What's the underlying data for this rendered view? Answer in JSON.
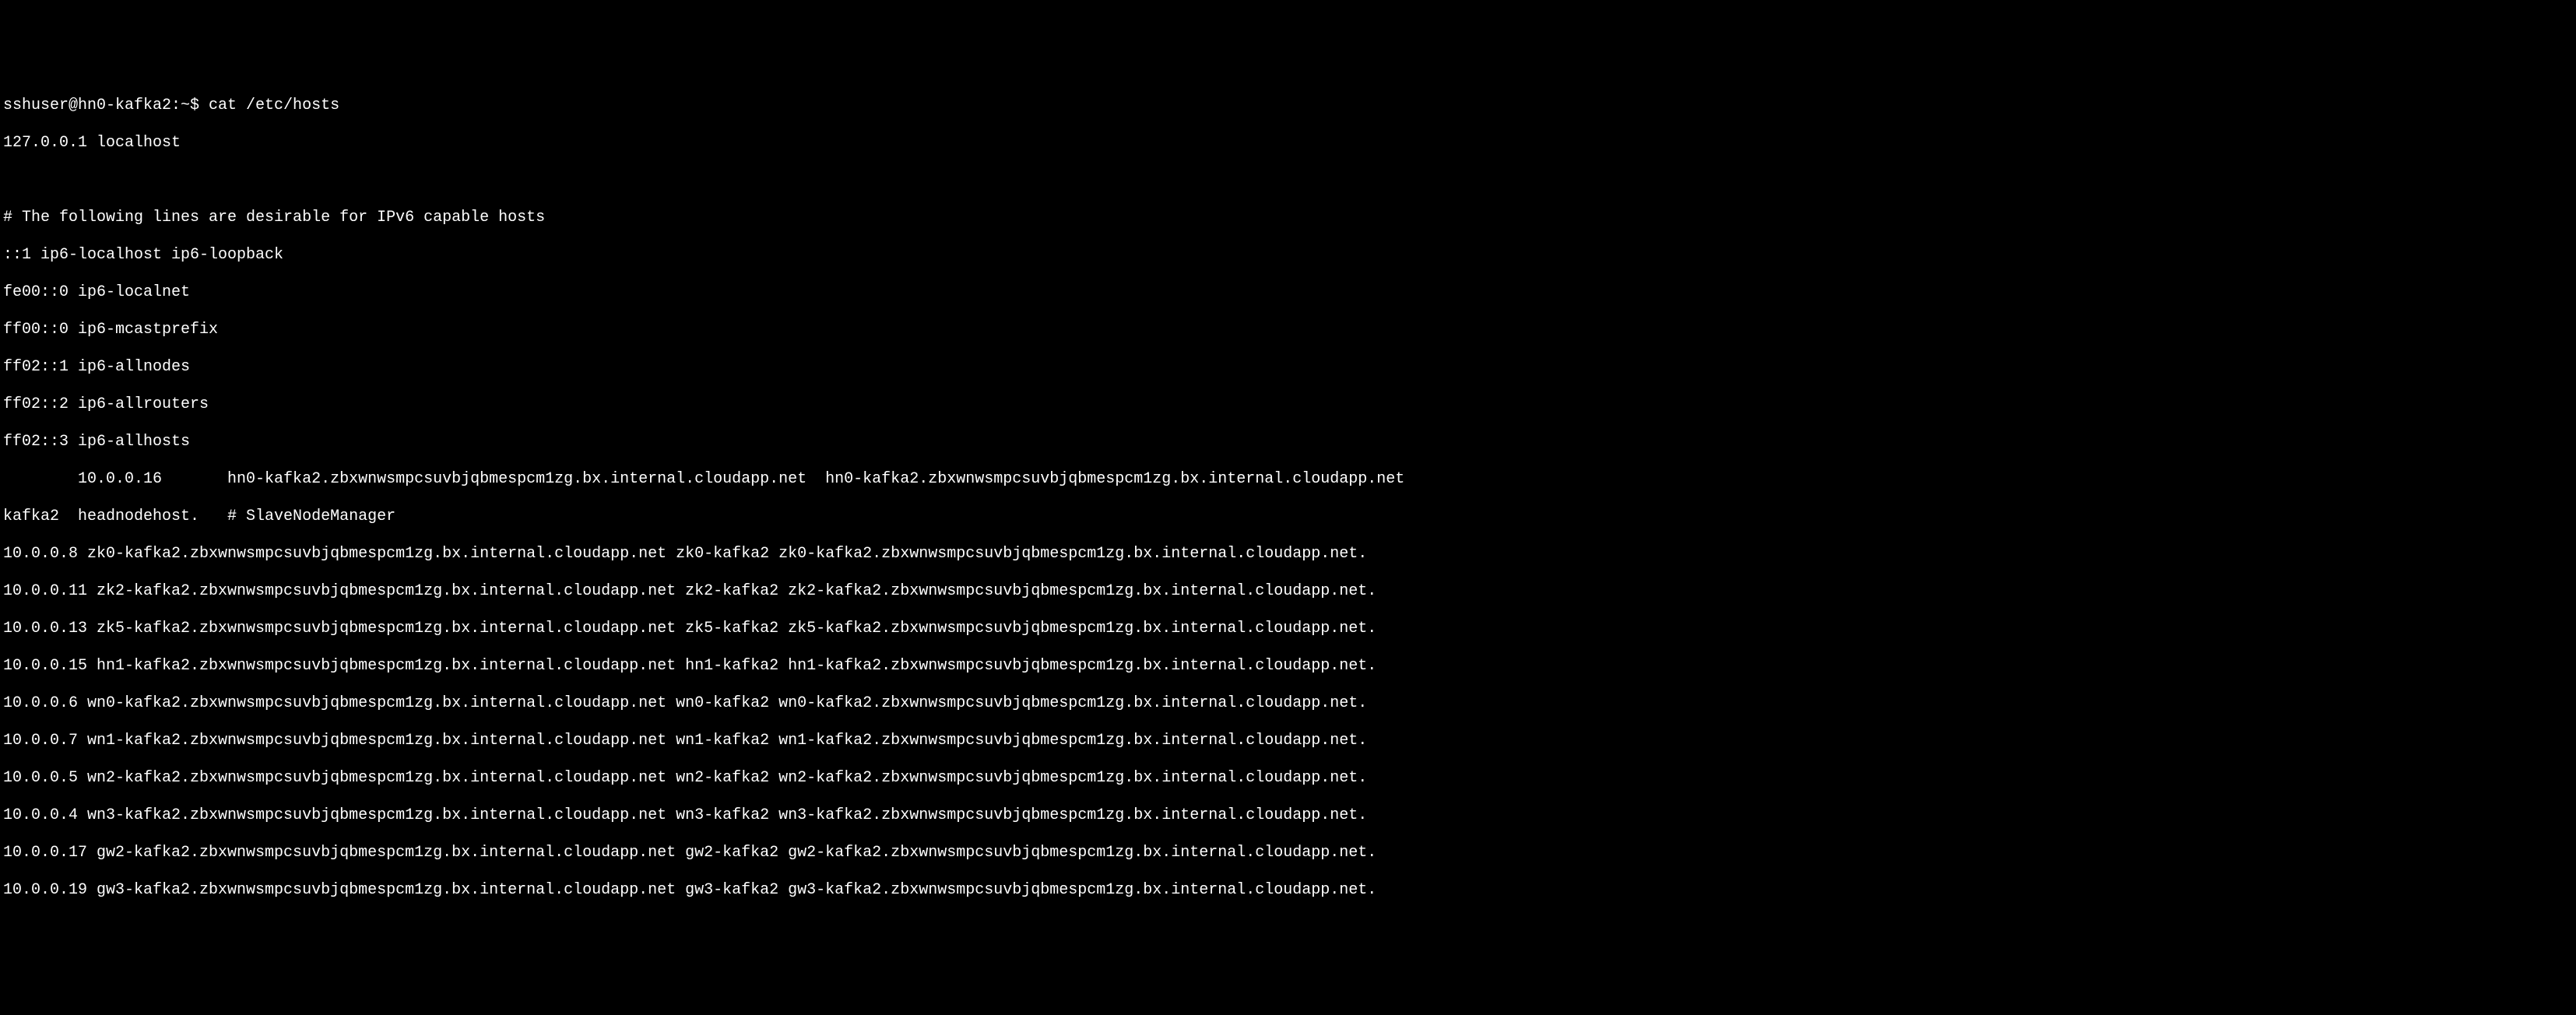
{
  "terminal": {
    "prompt_line": "sshuser@hn0-kafka2:~$ cat /etc/hosts",
    "lines": [
      "127.0.0.1 localhost",
      "",
      "# The following lines are desirable for IPv6 capable hosts",
      "::1 ip6-localhost ip6-loopback",
      "fe00::0 ip6-localnet",
      "ff00::0 ip6-mcastprefix",
      "ff02::1 ip6-allnodes",
      "ff02::2 ip6-allrouters",
      "ff02::3 ip6-allhosts",
      "        10.0.0.16       hn0-kafka2.zbxwnwsmpcsuvbjqbmespcm1zg.bx.internal.cloudapp.net  hn0-kafka2.zbxwnwsmpcsuvbjqbmespcm1zg.bx.internal.cloudapp.net",
      "kafka2  headnodehost.   # SlaveNodeManager",
      "10.0.0.8 zk0-kafka2.zbxwnwsmpcsuvbjqbmespcm1zg.bx.internal.cloudapp.net zk0-kafka2 zk0-kafka2.zbxwnwsmpcsuvbjqbmespcm1zg.bx.internal.cloudapp.net.",
      "10.0.0.11 zk2-kafka2.zbxwnwsmpcsuvbjqbmespcm1zg.bx.internal.cloudapp.net zk2-kafka2 zk2-kafka2.zbxwnwsmpcsuvbjqbmespcm1zg.bx.internal.cloudapp.net.",
      "10.0.0.13 zk5-kafka2.zbxwnwsmpcsuvbjqbmespcm1zg.bx.internal.cloudapp.net zk5-kafka2 zk5-kafka2.zbxwnwsmpcsuvbjqbmespcm1zg.bx.internal.cloudapp.net.",
      "10.0.0.15 hn1-kafka2.zbxwnwsmpcsuvbjqbmespcm1zg.bx.internal.cloudapp.net hn1-kafka2 hn1-kafka2.zbxwnwsmpcsuvbjqbmespcm1zg.bx.internal.cloudapp.net.",
      "10.0.0.6 wn0-kafka2.zbxwnwsmpcsuvbjqbmespcm1zg.bx.internal.cloudapp.net wn0-kafka2 wn0-kafka2.zbxwnwsmpcsuvbjqbmespcm1zg.bx.internal.cloudapp.net.",
      "10.0.0.7 wn1-kafka2.zbxwnwsmpcsuvbjqbmespcm1zg.bx.internal.cloudapp.net wn1-kafka2 wn1-kafka2.zbxwnwsmpcsuvbjqbmespcm1zg.bx.internal.cloudapp.net.",
      "10.0.0.5 wn2-kafka2.zbxwnwsmpcsuvbjqbmespcm1zg.bx.internal.cloudapp.net wn2-kafka2 wn2-kafka2.zbxwnwsmpcsuvbjqbmespcm1zg.bx.internal.cloudapp.net.",
      "10.0.0.4 wn3-kafka2.zbxwnwsmpcsuvbjqbmespcm1zg.bx.internal.cloudapp.net wn3-kafka2 wn3-kafka2.zbxwnwsmpcsuvbjqbmespcm1zg.bx.internal.cloudapp.net.",
      "10.0.0.17 gw2-kafka2.zbxwnwsmpcsuvbjqbmespcm1zg.bx.internal.cloudapp.net gw2-kafka2 gw2-kafka2.zbxwnwsmpcsuvbjqbmespcm1zg.bx.internal.cloudapp.net.",
      "10.0.0.19 gw3-kafka2.zbxwnwsmpcsuvbjqbmespcm1zg.bx.internal.cloudapp.net gw3-kafka2 gw3-kafka2.zbxwnwsmpcsuvbjqbmespcm1zg.bx.internal.cloudapp.net."
    ]
  }
}
